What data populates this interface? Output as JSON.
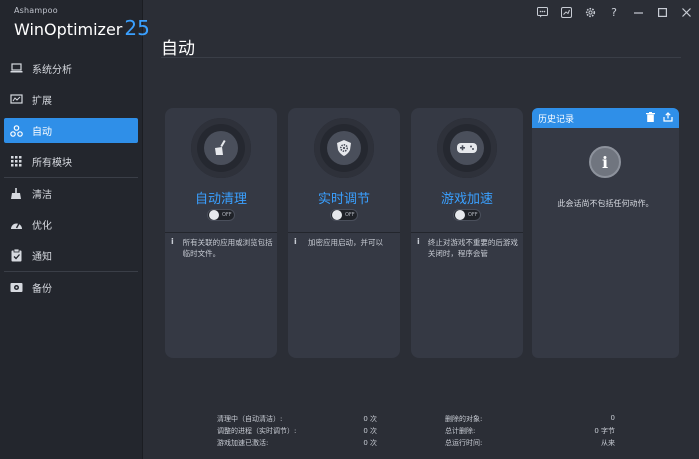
{
  "brand": {
    "small": "Ashampoo",
    "name": "WinOptimizer",
    "version": "25"
  },
  "nav": [
    {
      "label": "系统分析",
      "icon": "laptop-icon"
    },
    {
      "label": "扩展",
      "icon": "chart-icon"
    },
    {
      "label": "自动",
      "icon": "nodes-icon",
      "active": true
    },
    {
      "label": "所有模块",
      "icon": "grid-icon"
    },
    {
      "label": "清洁",
      "icon": "broom-icon"
    },
    {
      "label": "优化",
      "icon": "speedometer-icon"
    },
    {
      "label": "通知",
      "icon": "clipboard-icon"
    },
    {
      "label": "备份",
      "icon": "backup-icon"
    }
  ],
  "titlebar": [
    "feedback-icon",
    "chart-icon",
    "gear-icon",
    "help-icon",
    "minimize-icon",
    "maximize-icon",
    "close-icon"
  ],
  "page": {
    "title": "自动"
  },
  "cards": [
    {
      "title": "自动清理",
      "toggle": "OFF",
      "info": "所有关联的应用或浏览包括临时文件。",
      "icon": "broom-icon"
    },
    {
      "title": "实时调节",
      "toggle": "OFF",
      "info": "加密应用启动，并可以",
      "icon": "shield-gear-icon"
    },
    {
      "title": "游戏加速",
      "toggle": "OFF",
      "info": "终止对游戏不重要的后游戏关闭时，程序会管",
      "icon": "gamepad-icon"
    }
  ],
  "history": {
    "title": "历史记录",
    "message": "此会话尚不包括任何动作。",
    "info_glyph": "i"
  },
  "stats_left": [
    {
      "label": "清理中（自动清洁）:",
      "value": "0 次"
    },
    {
      "label": "调整的进程（实时调节）:",
      "value": "0 次"
    },
    {
      "label": "游戏加速已激活:",
      "value": "0 次"
    }
  ],
  "stats_right": [
    {
      "label": "删除的对象:",
      "value": "0"
    },
    {
      "label": "总计删除:",
      "value": "0 字节"
    },
    {
      "label": "总运行时间:",
      "value": "从来"
    }
  ],
  "colors": {
    "accent": "#2f8fe8",
    "card_title": "#3aa0ff",
    "background": "#2b2e36",
    "sidebar": "#23262d"
  }
}
